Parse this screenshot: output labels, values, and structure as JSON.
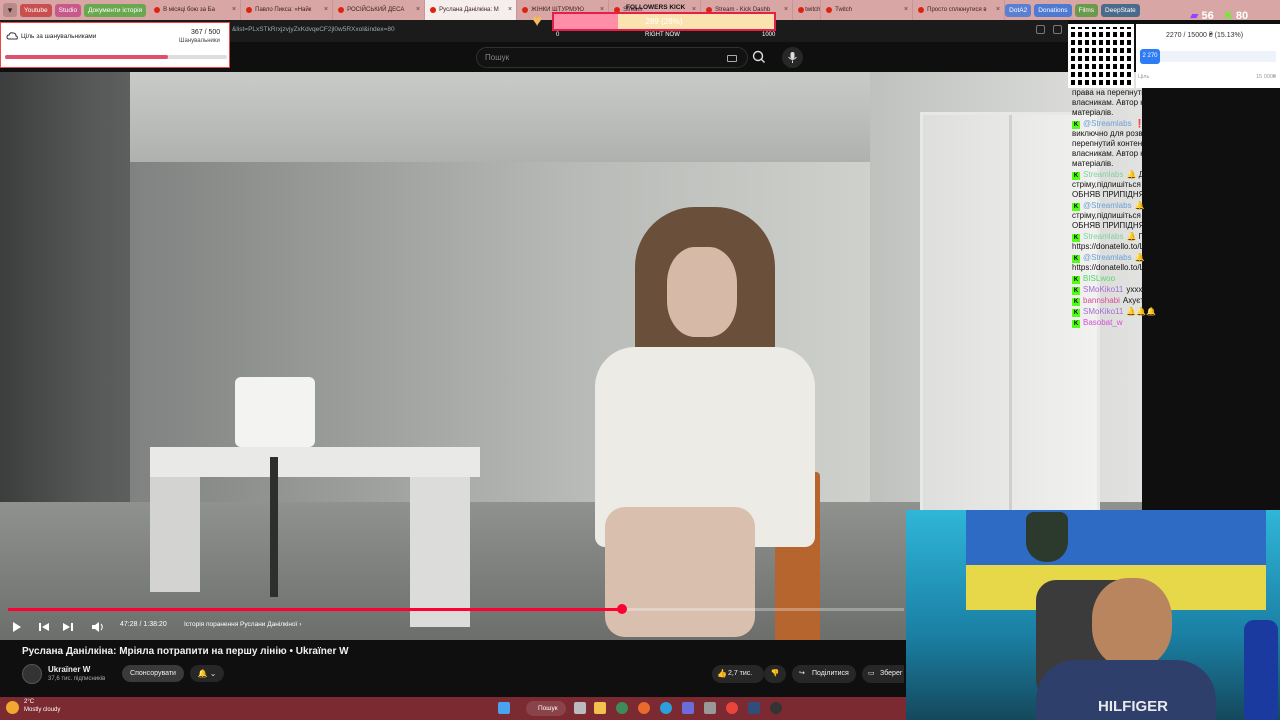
{
  "browser": {
    "bookmarks": [
      {
        "label": "Youtube",
        "color": "#c94e4e"
      },
      {
        "label": "Studio",
        "color": "#c75a8a"
      },
      {
        "label": "Документи історія",
        "color": "#6aa84f"
      }
    ],
    "tabs": [
      {
        "label": "В місяці бою за Ба"
      },
      {
        "label": "Павло Пикса: «Найк"
      },
      {
        "label": "РОСІЙСЬКИЙ ДЕСА"
      },
      {
        "label": "Руслана Данілкіна: М",
        "active": true
      },
      {
        "label": "ЖІНКИ ШТУРМУЮ"
      },
      {
        "label": "Stream"
      },
      {
        "label": "Stream - Kick Dashb"
      },
      {
        "label": "twitch"
      },
      {
        "label": "Twitch"
      },
      {
        "label": "Просто сплюнутися в"
      }
    ],
    "right_bookmarks": [
      {
        "label": "DotA2",
        "color": "#5b7fd1"
      },
      {
        "label": "Donations",
        "color": "#4e7ad1"
      },
      {
        "label": "Films",
        "color": "#6b9a4f"
      },
      {
        "label": "DeepState",
        "color": "#4a6c8a"
      }
    ],
    "address_text": "&list=PLxSTkRrxjzvjyZxKdvqeCF2jl0w5RXxol&index=80"
  },
  "youtube": {
    "search_placeholder": "Пошук",
    "video": {
      "title": "Руслана Данілкіна: Мріяла потрапити на першу лінію • Ukraїner W",
      "time_current": "47:28",
      "time_total": "1:38:20",
      "timecode": "47:28 / 1:38:20",
      "chapter": "Історія поранення Руслани Данілкіної",
      "progress_fraction": 0.685,
      "buffer_fraction": 0.715
    },
    "channel": {
      "name": "Ukraїner W",
      "subscribers": "37,6 тис. підписників",
      "sponsor_label": "Спонсорувати"
    },
    "actions": {
      "likes": "2,7 тис.",
      "share": "Поділитися",
      "save": "Зберег"
    }
  },
  "overlays": {
    "follower_goal": {
      "title": "FOLLOWERS KICK",
      "label": "289 (28%)",
      "fraction": 0.289,
      "min": "0",
      "mid": "RIGHT NOW",
      "max": "1000"
    },
    "fan_goal": {
      "label": "Ціль за шанувальниками",
      "count": "367",
      "total": "500",
      "count_text": "367 / 500",
      "sub": "Шанувальники",
      "fraction": 0.734
    },
    "counters": {
      "twitch": "56",
      "kick": "80"
    },
    "donation": {
      "text": "2270 / 15000 ₴ (15.13%)",
      "current": "2 270",
      "goal_label": "Ціль",
      "goal_max": "15 000₴"
    },
    "chat": [
      {
        "user": "",
        "text": "права на перепнутий контент належать їхнім законним власникам. Автор не претендує на авторство сторонніх матеріалів.",
        "color": "#111"
      },
      {
        "user": "@Streamlabs",
        "text": "❗Дисклеймер: Цей контент створено виключно для розважальних цілей. Усі права на перепнутий контент належать їхнім законним власникам. Автор не претендує на авторство сторонніх матеріалів.",
        "color": "#6aa0d6"
      },
      {
        "user": "Streamlabs",
        "text": "🔔 Друзі дякую за перегляд мого стріму,підпишіться на канал це важливо! ДЯКУЮ ОБНЯВ ПРИПІДНЯВ!",
        "color": "#7fd1a0"
      },
      {
        "user": "@Streamlabs",
        "text": "🔔 Друзі дякую за перегляд мого стріму,підпишіться на канал це важливо! ДЯКУЮ ОБНЯВ ПРИПІДНЯВ!",
        "color": "#6aa0d6"
      },
      {
        "user": "Streamlabs",
        "text": "🔔 Підтримай мене - https://donatello.to/LwowskyBanderos",
        "color": "#7fd1a0"
      },
      {
        "user": "@Streamlabs",
        "text": "🔔 Підтримай мене - https://donatello.to/LwowskyBanderos",
        "color": "#6aa0d6"
      },
      {
        "user": "BISLwoo",
        "text": "",
        "color": "#53d66b"
      },
      {
        "user": "SMoKiko11",
        "text": "уххххх яка історія",
        "color": "#a56bd6"
      },
      {
        "user": "bannshabi",
        "text": "Ахуєть",
        "color": "#d64b9a"
      },
      {
        "user": "SMoKiko11",
        "text": "🔔🔔🔔",
        "color": "#a56bd6"
      },
      {
        "user": "Basobat_w",
        "text": "",
        "color": "#d64bd6"
      }
    ]
  },
  "taskbar": {
    "temp": "2°C",
    "weather": "Mostly cloudy",
    "search_label": "Пошук"
  },
  "webcam": {
    "shirt_text": "HILFIGER"
  }
}
